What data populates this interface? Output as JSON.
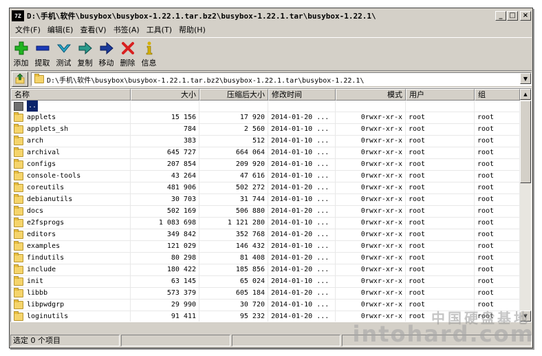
{
  "window": {
    "icon_label": "7Z",
    "title": "D:\\手机\\软件\\busybox\\busybox-1.22.1.tar.bz2\\busybox-1.22.1.tar\\busybox-1.22.1\\",
    "controls": {
      "minimize": "_",
      "maximize": "□",
      "close": "×"
    }
  },
  "menu": [
    "文件(F)",
    "编辑(E)",
    "查看(V)",
    "书签(A)",
    "工具(T)",
    "帮助(H)"
  ],
  "toolbar": [
    {
      "label": "添加",
      "icon": "add-icon",
      "color": "#22b422"
    },
    {
      "label": "提取",
      "icon": "extract-icon",
      "color": "#1a3ab8"
    },
    {
      "label": "测试",
      "icon": "test-icon",
      "color": "#2aa8c8"
    },
    {
      "label": "复制",
      "icon": "copy-icon",
      "color": "#2a9a8a"
    },
    {
      "label": "移动",
      "icon": "move-icon",
      "color": "#1a3a9a"
    },
    {
      "label": "删除",
      "icon": "delete-icon",
      "color": "#d82020"
    },
    {
      "label": "信息",
      "icon": "info-icon",
      "color": "#d4b000"
    }
  ],
  "address": {
    "path": "D:\\手机\\软件\\busybox\\busybox-1.22.1.tar.bz2\\busybox-1.22.1.tar\\busybox-1.22.1\\"
  },
  "columns": {
    "name": "名称",
    "size": "大小",
    "packed": "压缩后大小",
    "modified": "修改时间",
    "mode": "模式",
    "user": "用户",
    "group": "组"
  },
  "parent_row": "..",
  "rows": [
    {
      "name": "applets",
      "size": "15 156",
      "packed": "17 920",
      "modified": "2014-01-20 ...",
      "mode": "0rwxr-xr-x",
      "user": "root",
      "group": "root"
    },
    {
      "name": "applets_sh",
      "size": "784",
      "packed": "2 560",
      "modified": "2014-01-10 ...",
      "mode": "0rwxr-xr-x",
      "user": "root",
      "group": "root"
    },
    {
      "name": "arch",
      "size": "383",
      "packed": "512",
      "modified": "2014-01-10 ...",
      "mode": "0rwxr-xr-x",
      "user": "root",
      "group": "root"
    },
    {
      "name": "archival",
      "size": "645 727",
      "packed": "664 064",
      "modified": "2014-01-10 ...",
      "mode": "0rwxr-xr-x",
      "user": "root",
      "group": "root"
    },
    {
      "name": "configs",
      "size": "207 854",
      "packed": "209 920",
      "modified": "2014-01-10 ...",
      "mode": "0rwxr-xr-x",
      "user": "root",
      "group": "root"
    },
    {
      "name": "console-tools",
      "size": "43 264",
      "packed": "47 616",
      "modified": "2014-01-10 ...",
      "mode": "0rwxr-xr-x",
      "user": "root",
      "group": "root"
    },
    {
      "name": "coreutils",
      "size": "481 906",
      "packed": "502 272",
      "modified": "2014-01-20 ...",
      "mode": "0rwxr-xr-x",
      "user": "root",
      "group": "root"
    },
    {
      "name": "debianutils",
      "size": "30 703",
      "packed": "31 744",
      "modified": "2014-01-10 ...",
      "mode": "0rwxr-xr-x",
      "user": "root",
      "group": "root"
    },
    {
      "name": "docs",
      "size": "502 169",
      "packed": "506 880",
      "modified": "2014-01-20 ...",
      "mode": "0rwxr-xr-x",
      "user": "root",
      "group": "root"
    },
    {
      "name": "e2fsprogs",
      "size": "1 083 698",
      "packed": "1 121 280",
      "modified": "2014-01-10 ...",
      "mode": "0rwxr-xr-x",
      "user": "root",
      "group": "root"
    },
    {
      "name": "editors",
      "size": "349 842",
      "packed": "352 768",
      "modified": "2014-01-20 ...",
      "mode": "0rwxr-xr-x",
      "user": "root",
      "group": "root"
    },
    {
      "name": "examples",
      "size": "121 029",
      "packed": "146 432",
      "modified": "2014-01-10 ...",
      "mode": "0rwxr-xr-x",
      "user": "root",
      "group": "root"
    },
    {
      "name": "findutils",
      "size": "80 298",
      "packed": "81 408",
      "modified": "2014-01-20 ...",
      "mode": "0rwxr-xr-x",
      "user": "root",
      "group": "root"
    },
    {
      "name": "include",
      "size": "180 422",
      "packed": "185 856",
      "modified": "2014-01-20 ...",
      "mode": "0rwxr-xr-x",
      "user": "root",
      "group": "root"
    },
    {
      "name": "init",
      "size": "63 145",
      "packed": "65 024",
      "modified": "2014-01-10 ...",
      "mode": "0rwxr-xr-x",
      "user": "root",
      "group": "root"
    },
    {
      "name": "libbb",
      "size": "573 379",
      "packed": "605 184",
      "modified": "2014-01-20 ...",
      "mode": "0rwxr-xr-x",
      "user": "root",
      "group": "root"
    },
    {
      "name": "libpwdgrp",
      "size": "29 990",
      "packed": "30 720",
      "modified": "2014-01-10 ...",
      "mode": "0rwxr-xr-x",
      "user": "root",
      "group": "root"
    },
    {
      "name": "loginutils",
      "size": "91 411",
      "packed": "95 232",
      "modified": "2014-01-20 ...",
      "mode": "0rwxr-xr-x",
      "user": "root",
      "group": "root"
    }
  ],
  "status": {
    "selection": "选定 0 个项目"
  },
  "watermark": {
    "cn": "中国硬盘基地",
    "en": "intohard.com"
  }
}
